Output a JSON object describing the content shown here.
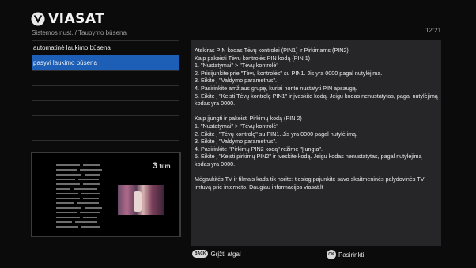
{
  "brand": {
    "name": "VIASAT"
  },
  "breadcrumb": "Sistemos nust. / Taupymo būsena",
  "clock": "12:21",
  "menu": {
    "items": [
      {
        "label": "automatinė laukimo būsena",
        "selected": false
      },
      {
        "label": "pasyvi laukimo būsena",
        "selected": true
      }
    ]
  },
  "preview": {
    "channel_logo": "film",
    "channel_number": "3"
  },
  "info": {
    "lines": [
      "Atskiras PIN kodas Tėvų kontrolei (PIN1) ir Pirkimams (PIN2)",
      "Kaip pakeisti Tėvų kontrolės PIN kodą (PIN 1)",
      "1. \"Nustatymai\" > \"Tėvų kontrolė\"",
      "2. Prisijunkite prie \"Tėvų kontrolės\" su PIN1. Jis yra 0000 pagal nutylėjimą.",
      "3. Eikite į \"Valdymo parametrus\".",
      "4. Pasirinkite amžiaus grupę, kuriai norite nustatyti PIN apsaugą.",
      "5. Eikite į \"Keisti Tėvų kontrolę PIN1\" ir įveskite kodą. Jeigu kodas nenustatytas, pagal nutylėjimą kodas yra 0000.",
      "",
      "Kaip įjungti ir pakeisti Pirkimų kodą (PIN 2)",
      "1. \"Nustatymai\" > \"Tėvų kontrolė\"",
      "2. Eikite į \"Tėvų kontrolę\" su PIN1. Jis yra 0000 pagal nutylėjimą.",
      "3. Eikite į \"Valdymo parametrus\".",
      "4. Pasirinkite \"Pirkimų PIN2 kodą\" režime \"Įjungta\".",
      "5. Eikite į \"Keisti pirkimų PIN2\" ir įveskite kodą. Jeigu kodas nenustatytas, pagal nutylėjimą kodas yra 0000.",
      "",
      "Mėgaukitės TV ir filmais kada tik norite: tiesiog pajunkite savo skaitmeninės palydovinės TV imtuvą prie interneto. Daugiau informacijos viasat.lt"
    ]
  },
  "footer": {
    "back_key": "BACK",
    "back_label": "Grįžti atgal",
    "ok_key": "OK",
    "ok_label": "Pasirinkti"
  },
  "colors": {
    "highlight": "#1d5fb7",
    "panel": "#262628",
    "background": "#0b0b0c"
  }
}
